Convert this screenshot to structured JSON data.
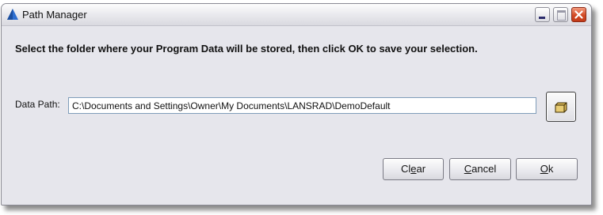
{
  "window": {
    "title": "Path Manager"
  },
  "instruction": "Select the folder where your Program Data will be stored, then click OK to save your selection.",
  "data_path": {
    "label": "Data Path:",
    "value": "C:\\Documents and Settings\\Owner\\My Documents\\LANSRAD\\DemoDefault"
  },
  "buttons": {
    "clear": {
      "pre": "Cl",
      "hotkey": "e",
      "post": "ar"
    },
    "cancel": {
      "pre": "",
      "hotkey": "C",
      "post": "ancel"
    },
    "ok": {
      "pre": "",
      "hotkey": "O",
      "post": "k"
    }
  },
  "icons": {
    "app": "lansrad-triangle-icon",
    "browse": "folder-browse-icon",
    "minimize": "minimize-icon",
    "maximize": "maximize-icon",
    "close": "close-icon"
  },
  "colors": {
    "window_bg": "#e6e6ec",
    "close_button": "#d24a25",
    "app_icon": "#2e6fd0"
  }
}
